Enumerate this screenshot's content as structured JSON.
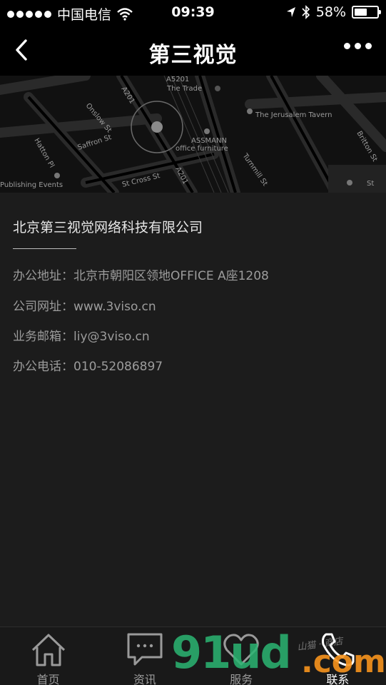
{
  "status_bar": {
    "carrier": "中国电信",
    "time": "09:39",
    "battery_percent": "58%",
    "battery_level": 0.58,
    "icons": [
      "signal-dots-icon",
      "wifi-icon",
      "location-arrow-icon",
      "bluetooth-icon",
      "battery-icon"
    ]
  },
  "nav": {
    "title": "第三视觉",
    "back_icon": "chevron-left-icon",
    "more_icon": "more-dots-icon"
  },
  "map": {
    "labels": {
      "a5201": "A5201",
      "the_trade": "The Trade",
      "onslow": "Onslow St",
      "a201_top": "A201",
      "jerusalem": "The Jerusalem Tavern",
      "britton": "Britton St",
      "saffron": "Saffron St",
      "assmann": "ASSMANN",
      "office_furniture": "office furniture",
      "turnmill": "Turnmill St",
      "hatton": "Hatton Pl",
      "st_cross": "St Cross St",
      "a201_bottom": "A201",
      "publishing": "Publishing Events",
      "st_right": "St"
    }
  },
  "company": {
    "name": "北京第三视觉网络科技有限公司",
    "rows": [
      {
        "label": "办公地址：",
        "value": "北京市朝阳区领地OFFICE A座1208"
      },
      {
        "label": "公司网址：",
        "value": "www.3viso.cn"
      },
      {
        "label": "业务邮箱：",
        "value": "liy@3viso.cn"
      },
      {
        "label": "办公电话：",
        "value": "010-52086897"
      }
    ]
  },
  "tabs": [
    {
      "label": "首页",
      "icon": "home-icon"
    },
    {
      "label": "资讯",
      "icon": "chat-bubble-icon"
    },
    {
      "label": "服务",
      "icon": "heart-icon"
    },
    {
      "label": "联系",
      "icon": "phone-icon"
    }
  ],
  "watermark": {
    "brand": "91ud",
    "suffix": ".com",
    "tagline": "山猫 · 商店"
  },
  "colors": {
    "background": "#1c1c1c",
    "bar": "#000000",
    "watermark_green": "#2bb673",
    "watermark_orange": "#f7941d"
  }
}
